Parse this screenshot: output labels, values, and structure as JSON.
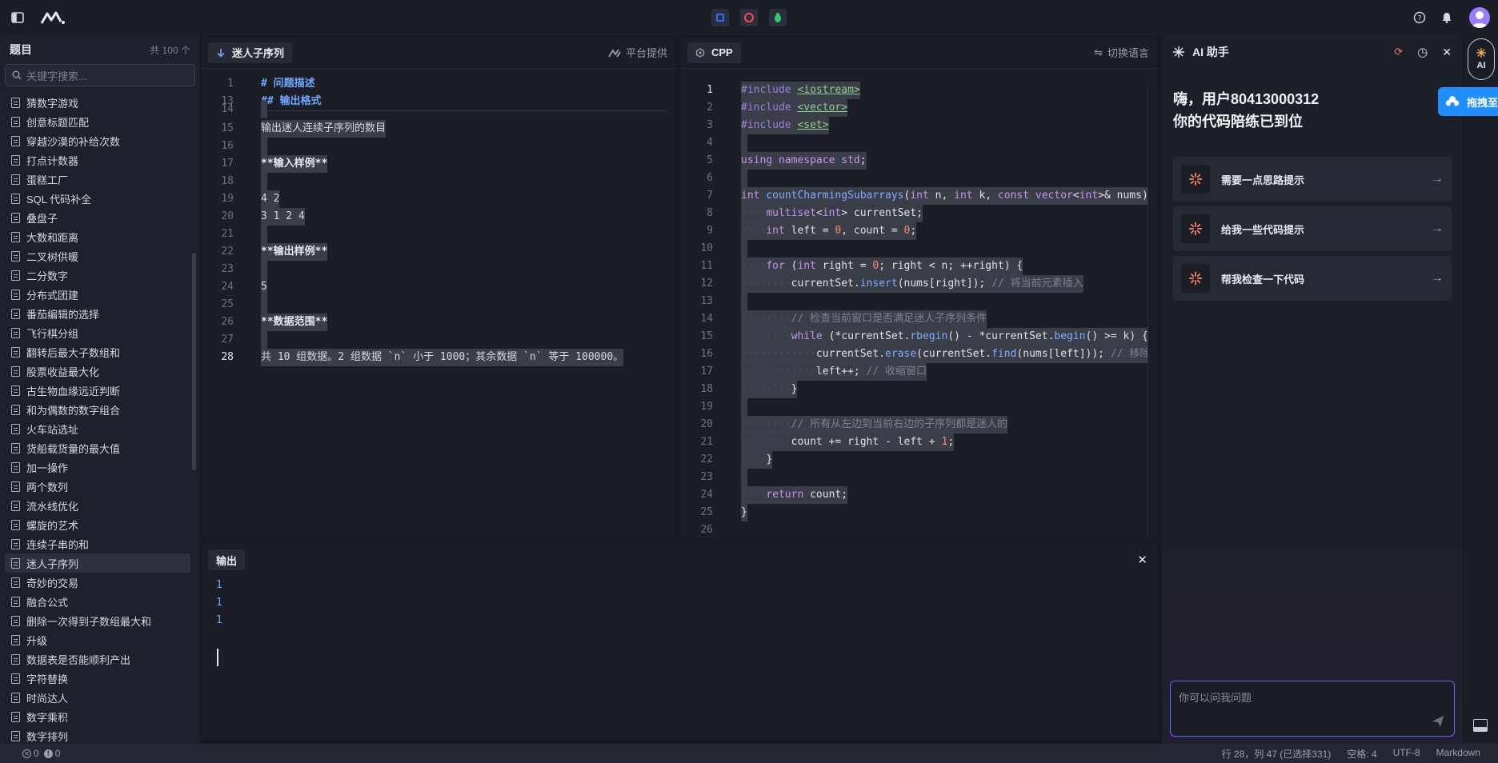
{
  "topbar": {
    "icons": [
      "sidebar-toggle-icon",
      "logo-icon",
      "stop-icon",
      "record-icon",
      "bug-icon",
      "help-icon",
      "bell-icon",
      "avatar-icon"
    ],
    "colors": {
      "stop": "#2f6bff",
      "record": "#ff4d4f",
      "bug": "#2ecc71"
    }
  },
  "sidebar": {
    "title": "题目",
    "count": "共 100 个",
    "search_placeholder": "关键字搜索...",
    "items": [
      "猜数字游戏",
      "创意标题匹配",
      "穿越沙漠的补给次数",
      "打点计数器",
      "蛋糕工厂",
      "SQL 代码补全",
      "叠盘子",
      "大数和距离",
      "二叉树供暖",
      "二分数字",
      "分布式团建",
      "番茄编辑的选择",
      "飞行棋分组",
      "翻转后最大子数组和",
      "股票收益最大化",
      "古生物血缘远近判断",
      "和为偶数的数字组合",
      "火车站选址",
      "货船载货量的最大值",
      "加一操作",
      "两个数列",
      "流水线优化",
      "螺旋的艺术",
      "连续子串的和",
      "迷人子序列",
      "奇妙的交易",
      "融合公式",
      "删除一次得到子数组最大和",
      "升级",
      "数据表是否能顺利产出",
      "字符替换",
      "时尚达人",
      "数字乘积",
      "数字排列"
    ],
    "active_index": 24
  },
  "problem_panel": {
    "tab_label": "迷人子序列",
    "right_label": "平台提供",
    "lines": [
      {
        "n": "1",
        "t": "# 问题描述",
        "k": "h"
      },
      {
        "n": "13",
        "t": "## 输出格式",
        "k": "h"
      },
      {
        "n": "14",
        "t": "",
        "k": "t"
      },
      {
        "n": "15",
        "t": "输出迷人连续子序列的数目",
        "k": "t"
      },
      {
        "n": "16",
        "t": "",
        "k": "t"
      },
      {
        "n": "17",
        "t": "**输入样例**",
        "k": "b"
      },
      {
        "n": "18",
        "t": "",
        "k": "t"
      },
      {
        "n": "19",
        "t": "4 2",
        "k": "t"
      },
      {
        "n": "20",
        "t": "3 1 2 4",
        "k": "t"
      },
      {
        "n": "21",
        "t": "",
        "k": "t"
      },
      {
        "n": "22",
        "t": "**输出样例**",
        "k": "b"
      },
      {
        "n": "23",
        "t": "",
        "k": "t"
      },
      {
        "n": "24",
        "t": "5",
        "k": "t"
      },
      {
        "n": "25",
        "t": "",
        "k": "t"
      },
      {
        "n": "26",
        "t": "**数据范围**",
        "k": "b"
      },
      {
        "n": "27",
        "t": "",
        "k": "t"
      },
      {
        "n": "28",
        "t": "共 10 组数据。2 组数据 `n` 小于 1000；其余数据 `n` 等于 100000。",
        "k": "t"
      }
    ]
  },
  "code_panel": {
    "tab_label": "CPP",
    "right_label": "切换语言",
    "lines": [
      {
        "n": "1",
        "indent": 0,
        "t": "#include <iostream>"
      },
      {
        "n": "2",
        "indent": 0,
        "t": "#include <vector>"
      },
      {
        "n": "3",
        "indent": 0,
        "t": "#include <set>"
      },
      {
        "n": "4",
        "indent": 0,
        "t": ""
      },
      {
        "n": "5",
        "indent": 0,
        "t": "using namespace std;"
      },
      {
        "n": "6",
        "indent": 0,
        "t": ""
      },
      {
        "n": "7",
        "indent": 0,
        "t": "int countCharmingSubarrays(int n, int k, const vector<int>& nums) {"
      },
      {
        "n": "8",
        "indent": 1,
        "t": "multiset<int> currentSet;"
      },
      {
        "n": "9",
        "indent": 1,
        "t": "int left = 0, count = 0;"
      },
      {
        "n": "10",
        "indent": 0,
        "t": ""
      },
      {
        "n": "11",
        "indent": 1,
        "t": "for (int right = 0; right < n; ++right) {"
      },
      {
        "n": "12",
        "indent": 2,
        "t": "currentSet.insert(nums[right]); // 将当前元素插入"
      },
      {
        "n": "13",
        "indent": 0,
        "t": ""
      },
      {
        "n": "14",
        "indent": 2,
        "t": "// 检查当前窗口是否满足迷人子序列条件"
      },
      {
        "n": "15",
        "indent": 2,
        "t": "while (*currentSet.rbegin() - *currentSet.begin() >= k) {"
      },
      {
        "n": "16",
        "indent": 3,
        "t": "currentSet.erase(currentSet.find(nums[left])); // 移除"
      },
      {
        "n": "17",
        "indent": 3,
        "t": "left++; // 收缩窗口"
      },
      {
        "n": "18",
        "indent": 2,
        "t": "}"
      },
      {
        "n": "19",
        "indent": 0,
        "t": ""
      },
      {
        "n": "20",
        "indent": 2,
        "t": "// 所有从左边到当前右边的子序列都是迷人的"
      },
      {
        "n": "21",
        "indent": 2,
        "t": "count += right - left + 1;"
      },
      {
        "n": "22",
        "indent": 1,
        "t": "}"
      },
      {
        "n": "23",
        "indent": 0,
        "t": ""
      },
      {
        "n": "24",
        "indent": 1,
        "t": "return count;"
      },
      {
        "n": "25",
        "indent": 0,
        "t": "}"
      },
      {
        "n": "26",
        "indent": 0,
        "t": ""
      }
    ]
  },
  "output_panel": {
    "tab_label": "输出",
    "lines": [
      "1",
      "1",
      "1"
    ]
  },
  "ai_panel": {
    "title": "AI 助手",
    "greeting_line1": "嗨，用户80413000312",
    "greeting_line2": "你的代码陪练已到位",
    "suggestions": [
      "需要一点思路提示",
      "给我一些代码提示",
      "帮我检查一下代码"
    ],
    "input_placeholder": "你可以问我问题"
  },
  "rail": {
    "ai_label": "AI",
    "drag_label": "拖拽至"
  },
  "status": {
    "errors": "0",
    "warnings": "0",
    "cursor": "行 28，列 47 (已选择331)",
    "spaces": "空格: 4",
    "encoding": "UTF-8",
    "language": "Markdown"
  }
}
